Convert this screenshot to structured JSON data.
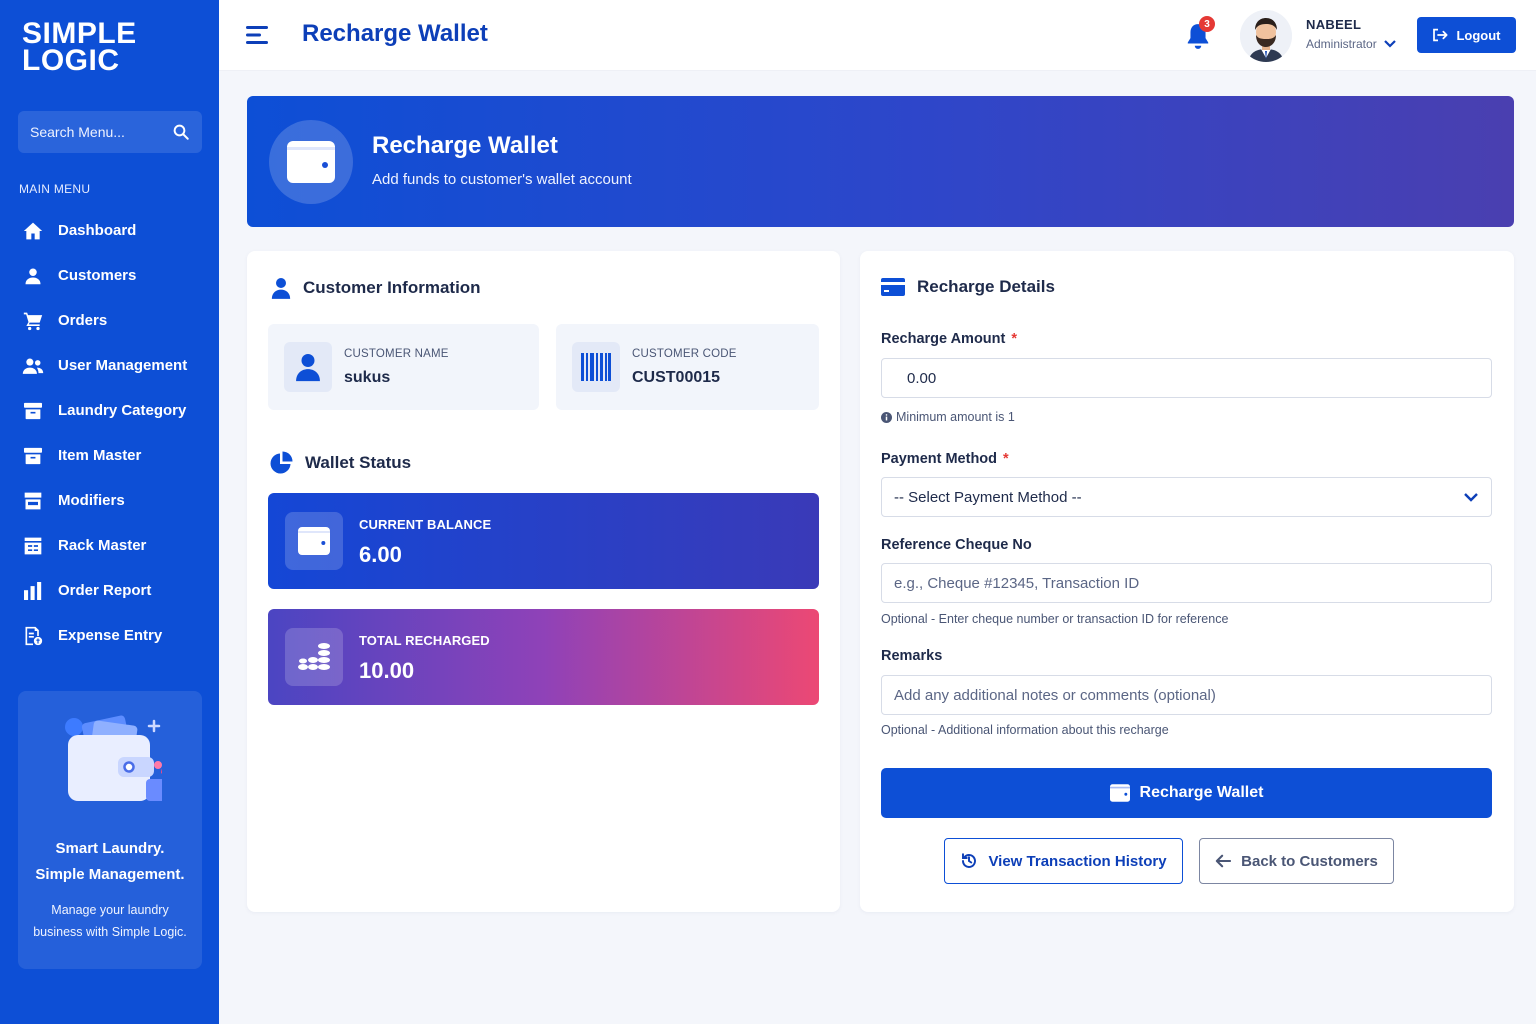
{
  "sidebar": {
    "logo_line1": "SIMPLE",
    "logo_line2": "LOGIC",
    "search_placeholder": "Search Menu...",
    "menu_title": "MAIN MENU",
    "items": [
      {
        "label": "Dashboard",
        "icon": "home-icon"
      },
      {
        "label": "Customers",
        "icon": "user-icon"
      },
      {
        "label": "Orders",
        "icon": "cart-icon"
      },
      {
        "label": "User Management",
        "icon": "users-icon"
      },
      {
        "label": "Laundry Category",
        "icon": "box-icon"
      },
      {
        "label": "Item Master",
        "icon": "box-icon"
      },
      {
        "label": "Modifiers",
        "icon": "store-icon"
      },
      {
        "label": "Rack Master",
        "icon": "rack-icon"
      },
      {
        "label": "Order Report",
        "icon": "bar-chart-icon"
      },
      {
        "label": "Expense Entry",
        "icon": "receipt-icon"
      }
    ],
    "promo": {
      "title_line1": "Smart Laundry.",
      "title_line2": "Simple Management.",
      "text": "Manage your laundry business with Simple Logic."
    }
  },
  "header": {
    "title": "Recharge Wallet",
    "notification_count": "3",
    "user_name": "NABEEL",
    "user_role": "Administrator",
    "logout_label": "Logout"
  },
  "banner": {
    "title": "Recharge Wallet",
    "subtitle": "Add funds to customer's wallet account"
  },
  "customer": {
    "section_title": "Customer Information",
    "name_label": "CUSTOMER NAME",
    "name_value": "sukus",
    "code_label": "CUSTOMER CODE",
    "code_value": "CUST00015"
  },
  "wallet": {
    "section_title": "Wallet Status",
    "balance_label": "CURRENT BALANCE",
    "balance_value": "6.00",
    "recharged_label": "TOTAL RECHARGED",
    "recharged_value": "10.00"
  },
  "recharge": {
    "section_title": "Recharge Details",
    "amount_label": "Recharge Amount",
    "required_mark": "*",
    "amount_value": "0.00",
    "amount_hint": "Minimum amount is 1",
    "payment_label": "Payment Method",
    "payment_selected": "-- Select Payment Method --",
    "reference_label": "Reference Cheque No",
    "reference_placeholder": "e.g., Cheque #12345, Transaction ID",
    "reference_hint": "Optional - Enter cheque number or transaction ID for reference",
    "remarks_label": "Remarks",
    "remarks_placeholder": "Add any additional notes or comments (optional)",
    "remarks_hint": "Optional - Additional information about this recharge",
    "submit_label": "Recharge Wallet",
    "history_label": "View Transaction History",
    "back_label": "Back to Customers"
  },
  "colors": {
    "primary": "#0d4fd6",
    "danger": "#e53935",
    "accent_pink": "#ec4874"
  }
}
